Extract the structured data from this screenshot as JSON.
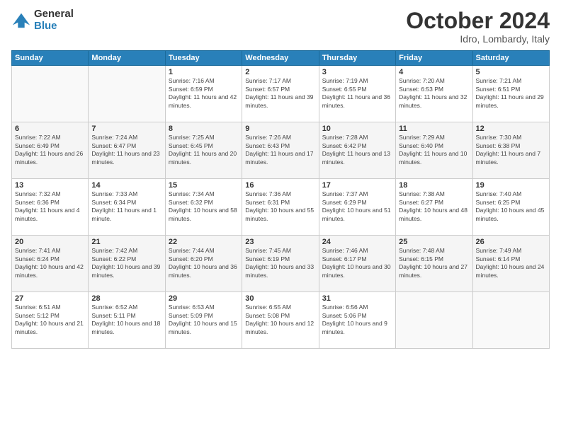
{
  "logo": {
    "general": "General",
    "blue": "Blue"
  },
  "header": {
    "title": "October 2024",
    "subtitle": "Idro, Lombardy, Italy"
  },
  "weekdays": [
    "Sunday",
    "Monday",
    "Tuesday",
    "Wednesday",
    "Thursday",
    "Friday",
    "Saturday"
  ],
  "weeks": [
    [
      {
        "day": "",
        "sunrise": "",
        "sunset": "",
        "daylight": ""
      },
      {
        "day": "",
        "sunrise": "",
        "sunset": "",
        "daylight": ""
      },
      {
        "day": "1",
        "sunrise": "Sunrise: 7:16 AM",
        "sunset": "Sunset: 6:59 PM",
        "daylight": "Daylight: 11 hours and 42 minutes."
      },
      {
        "day": "2",
        "sunrise": "Sunrise: 7:17 AM",
        "sunset": "Sunset: 6:57 PM",
        "daylight": "Daylight: 11 hours and 39 minutes."
      },
      {
        "day": "3",
        "sunrise": "Sunrise: 7:19 AM",
        "sunset": "Sunset: 6:55 PM",
        "daylight": "Daylight: 11 hours and 36 minutes."
      },
      {
        "day": "4",
        "sunrise": "Sunrise: 7:20 AM",
        "sunset": "Sunset: 6:53 PM",
        "daylight": "Daylight: 11 hours and 32 minutes."
      },
      {
        "day": "5",
        "sunrise": "Sunrise: 7:21 AM",
        "sunset": "Sunset: 6:51 PM",
        "daylight": "Daylight: 11 hours and 29 minutes."
      }
    ],
    [
      {
        "day": "6",
        "sunrise": "Sunrise: 7:22 AM",
        "sunset": "Sunset: 6:49 PM",
        "daylight": "Daylight: 11 hours and 26 minutes."
      },
      {
        "day": "7",
        "sunrise": "Sunrise: 7:24 AM",
        "sunset": "Sunset: 6:47 PM",
        "daylight": "Daylight: 11 hours and 23 minutes."
      },
      {
        "day": "8",
        "sunrise": "Sunrise: 7:25 AM",
        "sunset": "Sunset: 6:45 PM",
        "daylight": "Daylight: 11 hours and 20 minutes."
      },
      {
        "day": "9",
        "sunrise": "Sunrise: 7:26 AM",
        "sunset": "Sunset: 6:43 PM",
        "daylight": "Daylight: 11 hours and 17 minutes."
      },
      {
        "day": "10",
        "sunrise": "Sunrise: 7:28 AM",
        "sunset": "Sunset: 6:42 PM",
        "daylight": "Daylight: 11 hours and 13 minutes."
      },
      {
        "day": "11",
        "sunrise": "Sunrise: 7:29 AM",
        "sunset": "Sunset: 6:40 PM",
        "daylight": "Daylight: 11 hours and 10 minutes."
      },
      {
        "day": "12",
        "sunrise": "Sunrise: 7:30 AM",
        "sunset": "Sunset: 6:38 PM",
        "daylight": "Daylight: 11 hours and 7 minutes."
      }
    ],
    [
      {
        "day": "13",
        "sunrise": "Sunrise: 7:32 AM",
        "sunset": "Sunset: 6:36 PM",
        "daylight": "Daylight: 11 hours and 4 minutes."
      },
      {
        "day": "14",
        "sunrise": "Sunrise: 7:33 AM",
        "sunset": "Sunset: 6:34 PM",
        "daylight": "Daylight: 11 hours and 1 minute."
      },
      {
        "day": "15",
        "sunrise": "Sunrise: 7:34 AM",
        "sunset": "Sunset: 6:32 PM",
        "daylight": "Daylight: 10 hours and 58 minutes."
      },
      {
        "day": "16",
        "sunrise": "Sunrise: 7:36 AM",
        "sunset": "Sunset: 6:31 PM",
        "daylight": "Daylight: 10 hours and 55 minutes."
      },
      {
        "day": "17",
        "sunrise": "Sunrise: 7:37 AM",
        "sunset": "Sunset: 6:29 PM",
        "daylight": "Daylight: 10 hours and 51 minutes."
      },
      {
        "day": "18",
        "sunrise": "Sunrise: 7:38 AM",
        "sunset": "Sunset: 6:27 PM",
        "daylight": "Daylight: 10 hours and 48 minutes."
      },
      {
        "day": "19",
        "sunrise": "Sunrise: 7:40 AM",
        "sunset": "Sunset: 6:25 PM",
        "daylight": "Daylight: 10 hours and 45 minutes."
      }
    ],
    [
      {
        "day": "20",
        "sunrise": "Sunrise: 7:41 AM",
        "sunset": "Sunset: 6:24 PM",
        "daylight": "Daylight: 10 hours and 42 minutes."
      },
      {
        "day": "21",
        "sunrise": "Sunrise: 7:42 AM",
        "sunset": "Sunset: 6:22 PM",
        "daylight": "Daylight: 10 hours and 39 minutes."
      },
      {
        "day": "22",
        "sunrise": "Sunrise: 7:44 AM",
        "sunset": "Sunset: 6:20 PM",
        "daylight": "Daylight: 10 hours and 36 minutes."
      },
      {
        "day": "23",
        "sunrise": "Sunrise: 7:45 AM",
        "sunset": "Sunset: 6:19 PM",
        "daylight": "Daylight: 10 hours and 33 minutes."
      },
      {
        "day": "24",
        "sunrise": "Sunrise: 7:46 AM",
        "sunset": "Sunset: 6:17 PM",
        "daylight": "Daylight: 10 hours and 30 minutes."
      },
      {
        "day": "25",
        "sunrise": "Sunrise: 7:48 AM",
        "sunset": "Sunset: 6:15 PM",
        "daylight": "Daylight: 10 hours and 27 minutes."
      },
      {
        "day": "26",
        "sunrise": "Sunrise: 7:49 AM",
        "sunset": "Sunset: 6:14 PM",
        "daylight": "Daylight: 10 hours and 24 minutes."
      }
    ],
    [
      {
        "day": "27",
        "sunrise": "Sunrise: 6:51 AM",
        "sunset": "Sunset: 5:12 PM",
        "daylight": "Daylight: 10 hours and 21 minutes."
      },
      {
        "day": "28",
        "sunrise": "Sunrise: 6:52 AM",
        "sunset": "Sunset: 5:11 PM",
        "daylight": "Daylight: 10 hours and 18 minutes."
      },
      {
        "day": "29",
        "sunrise": "Sunrise: 6:53 AM",
        "sunset": "Sunset: 5:09 PM",
        "daylight": "Daylight: 10 hours and 15 minutes."
      },
      {
        "day": "30",
        "sunrise": "Sunrise: 6:55 AM",
        "sunset": "Sunset: 5:08 PM",
        "daylight": "Daylight: 10 hours and 12 minutes."
      },
      {
        "day": "31",
        "sunrise": "Sunrise: 6:56 AM",
        "sunset": "Sunset: 5:06 PM",
        "daylight": "Daylight: 10 hours and 9 minutes."
      },
      {
        "day": "",
        "sunrise": "",
        "sunset": "",
        "daylight": ""
      },
      {
        "day": "",
        "sunrise": "",
        "sunset": "",
        "daylight": ""
      }
    ]
  ]
}
